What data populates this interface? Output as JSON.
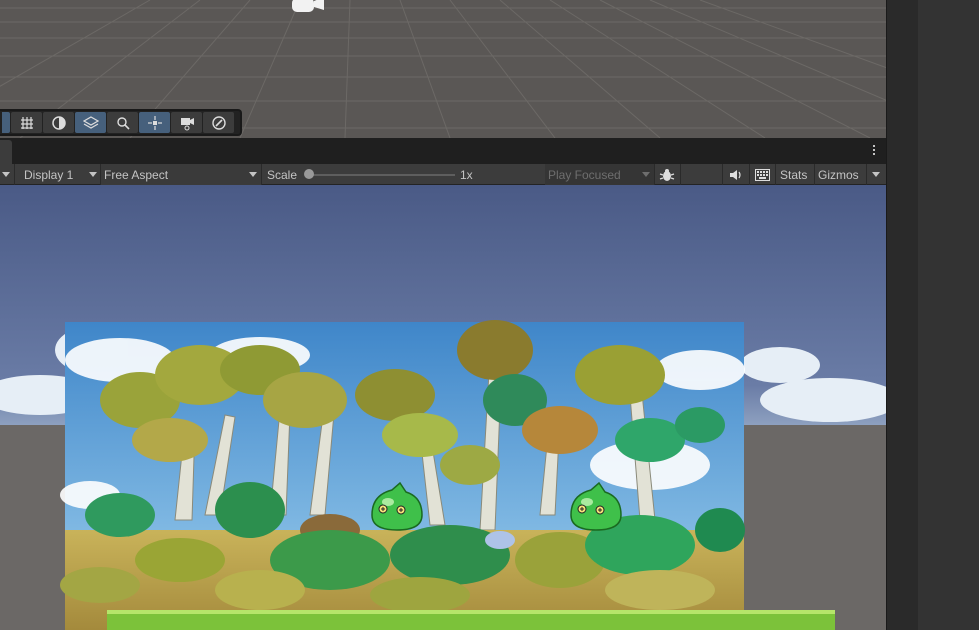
{
  "game_toolbar": {
    "display_label": "Display 1",
    "aspect_label": "Free Aspect",
    "scale_label": "Scale",
    "scale_value": "1x",
    "scale_fraction": 0.0,
    "play_mode_label": "Play Focused",
    "stats_label": "Stats",
    "gizmos_label": "Gizmos"
  },
  "icons": {
    "scene_tools": [
      "grid-snap-icon",
      "shading-icon",
      "layers-icon",
      "search-icon",
      "move-tool-icon",
      "camera-render-icon",
      "compass-icon"
    ],
    "game_tools": [
      "bug-icon",
      "audio-icon",
      "keyboard-icon",
      "menu-kebab-icon"
    ]
  },
  "colors": {
    "scene_background": "#5a5755",
    "toolbar_active": "#46607c",
    "panel_background": "#3c3c3c",
    "sky_top": "#4a5a86",
    "grass": "#7cc23a"
  }
}
